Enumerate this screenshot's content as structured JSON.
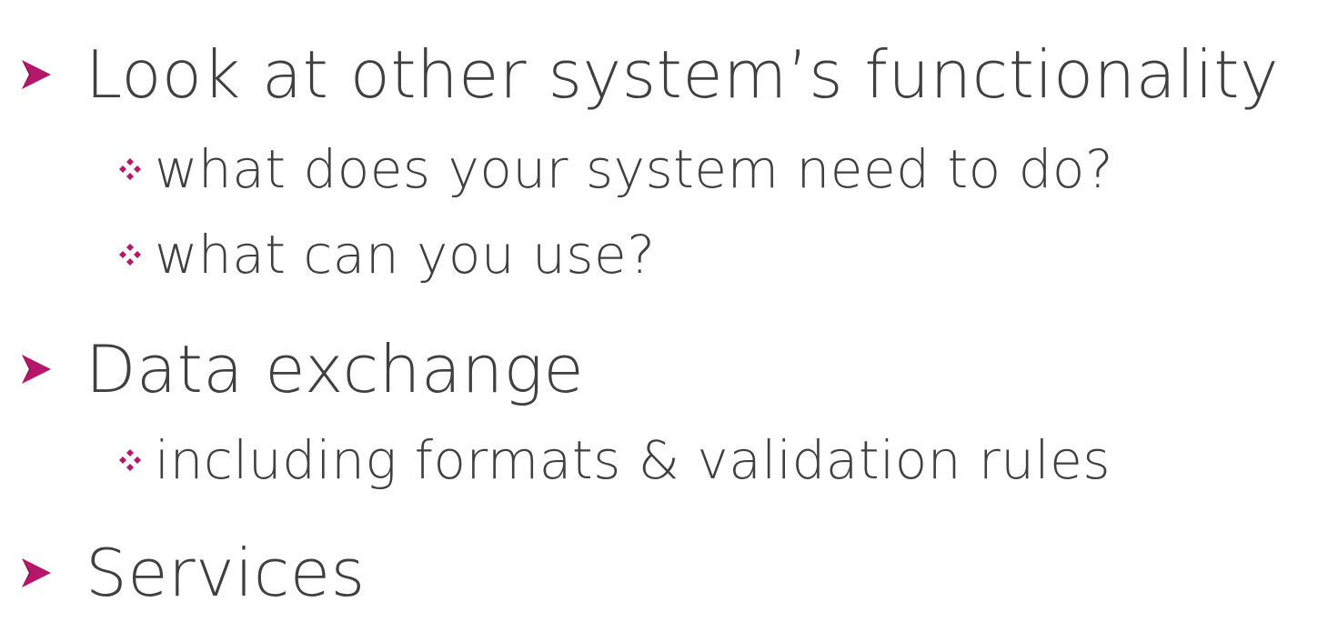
{
  "colors": {
    "bullet_accent": "#b5186b",
    "text": "#404040",
    "background": "#ffffff"
  },
  "icons": {
    "level1": "arrow-bullet-icon",
    "level2": "four-diamond-bullet-icon"
  },
  "bullets": [
    {
      "text": "Look at other system’s functionality",
      "subitems": [
        {
          "text": "what does your system need to do?"
        },
        {
          "text": "what can you use?"
        }
      ]
    },
    {
      "text": "Data exchange",
      "subitems": [
        {
          "text": "including formats & validation rules"
        }
      ]
    },
    {
      "text": "Services",
      "subitems": []
    }
  ]
}
